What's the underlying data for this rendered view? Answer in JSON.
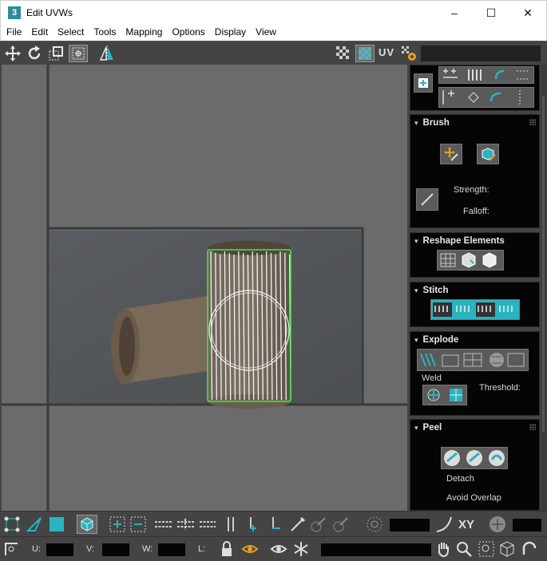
{
  "window": {
    "title": "Edit UVWs",
    "app_icon": "3"
  },
  "controls": {
    "minimize": "–",
    "maximize": "☐",
    "close": "✕"
  },
  "menu": [
    "File",
    "Edit",
    "Select",
    "Tools",
    "Mapping",
    "Options",
    "Display",
    "View"
  ],
  "toolbar": {
    "uv_label": "UV"
  },
  "panel": {
    "brush": {
      "title": "Brush",
      "strength": "Strength:",
      "falloff": "Falloff:"
    },
    "reshape": {
      "title": "Reshape Elements"
    },
    "stitch": {
      "title": "Stitch"
    },
    "explode": {
      "title": "Explode",
      "weld": "Weld",
      "threshold": "Threshold:"
    },
    "peel": {
      "title": "Peel",
      "detach": "Detach",
      "avoid_overlap": "Avoid Overlap"
    }
  },
  "bottom": {
    "u_label": "U:",
    "v_label": "V:",
    "w_label": "W:",
    "l_label": "L:",
    "xy_label": "XY"
  },
  "colors": {
    "accent": "#2ab3c0",
    "uv_edge": "#3df03d",
    "panel_bg": "#050505"
  }
}
